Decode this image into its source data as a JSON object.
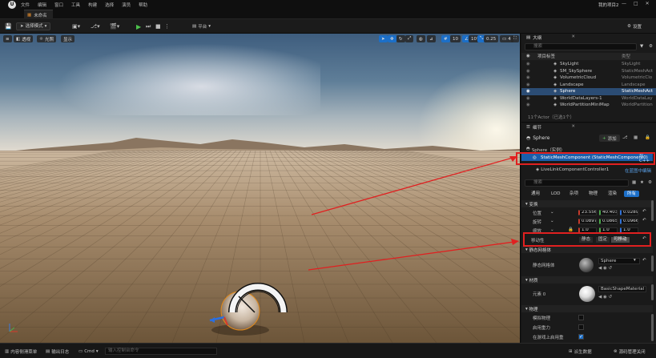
{
  "titlebar": {
    "logo": "U",
    "menus": [
      "文件",
      "编辑",
      "窗口",
      "工具",
      "构建",
      "选择",
      "演员",
      "帮助"
    ],
    "project": "我的项目2",
    "window_buttons": [
      "—",
      "□",
      "✕"
    ]
  },
  "tab": {
    "label": "未命名"
  },
  "toolbar": {
    "mode": "选择模式",
    "platform": "平台",
    "settings": "设置"
  },
  "viewport": {
    "perspective": "透视",
    "lit": "光照",
    "show": "显示",
    "grid_snap": "10",
    "rot_snap": "10°",
    "scale_snap": "0.25",
    "cam_speed": "4"
  },
  "outliner": {
    "tab": "大纲",
    "search_placeholder": "搜索",
    "col_label": "项目标签",
    "col_type": "类型",
    "rows": [
      {
        "name": "SkyLight",
        "type": "SkyLight"
      },
      {
        "name": "SM_SkySphere",
        "type": "StaticMeshAct"
      },
      {
        "name": "VolumetricCloud",
        "type": "VolumetricClo"
      },
      {
        "name": "Landscape",
        "type": "Landscape"
      },
      {
        "name": "Sphere",
        "type": "StaticMeshAct",
        "selected": true
      },
      {
        "name": "WorldDataLayers-1",
        "type": "WorldDataLay"
      },
      {
        "name": "WorldPartitionMiniMap",
        "type": "WorldPartition"
      }
    ],
    "count": "11个Actor（已选1个）"
  },
  "details": {
    "tab": "细节",
    "actor_name": "Sphere",
    "add_button": "添加",
    "root": "Sphere（实例）",
    "component": "StaticMeshComponent (StaticMeshComponent0)",
    "component_edit": "在C++",
    "livelink": "LiveLinkComponentController1",
    "livelink_edit": "在蓝图中编辑",
    "search_placeholder": "搜索",
    "filters": [
      "通用",
      "LOD",
      "杂项",
      "物理",
      "渲染",
      "所有"
    ],
    "transform_cat": "变换",
    "location_label": "位置",
    "location": [
      "23.5563",
      "40.4030",
      "0.02893"
    ],
    "rotation_label": "旋转",
    "rotation": [
      "0.08979",
      "0.08651",
      "0.0966°"
    ],
    "scale_label": "缩放",
    "scale": [
      "1.0",
      "1.0",
      "1.0"
    ],
    "mobility_label": "移动性",
    "mobility": [
      "静态",
      "固定",
      "可移动"
    ],
    "static_mesh_cat": "静态网格体",
    "static_mesh_label": "静态网格体",
    "static_mesh_value": "Sphere",
    "materials_cat": "材质",
    "element_label": "元素 0",
    "material_value": "BasicShapeMaterial",
    "physics_cat": "物理",
    "physics_rows": [
      "模拟物理",
      "启用重力",
      "在游戏上启用重"
    ]
  },
  "statusbar": {
    "content_drawer": "内容侧滑菜单",
    "output_log": "输出日志",
    "cmd": "Cmd",
    "cmd_placeholder": "输入控制台命令",
    "derived_data": "派生数据",
    "source_control": "源码管理关闭"
  },
  "colors": {
    "accent": "#1c6fc8",
    "annotation": "#e02020",
    "play": "#4cc24c"
  }
}
